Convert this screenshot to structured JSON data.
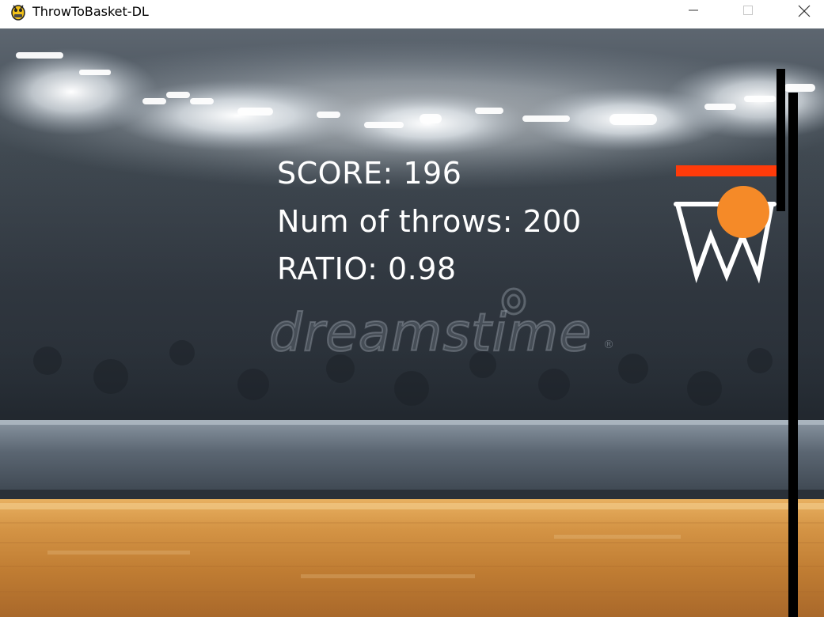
{
  "window": {
    "title": "ThrowToBasket-DL",
    "icon": "pygame-snake-icon",
    "controls": [
      "minimize-icon",
      "maximize-icon",
      "close-icon"
    ]
  },
  "hud": {
    "score": "SCORE: 196",
    "throws": "Num of throws: 200",
    "ratio": "RATIO: 0.98"
  },
  "watermark": {
    "text": "dreamstime",
    "registered": "®"
  },
  "colors": {
    "rim": "#ff3b0a",
    "ball": "#f58a28",
    "net": "#ffffff",
    "pole": "#000000",
    "hud_text": "#ffffff",
    "floor": "#c98a3d"
  }
}
